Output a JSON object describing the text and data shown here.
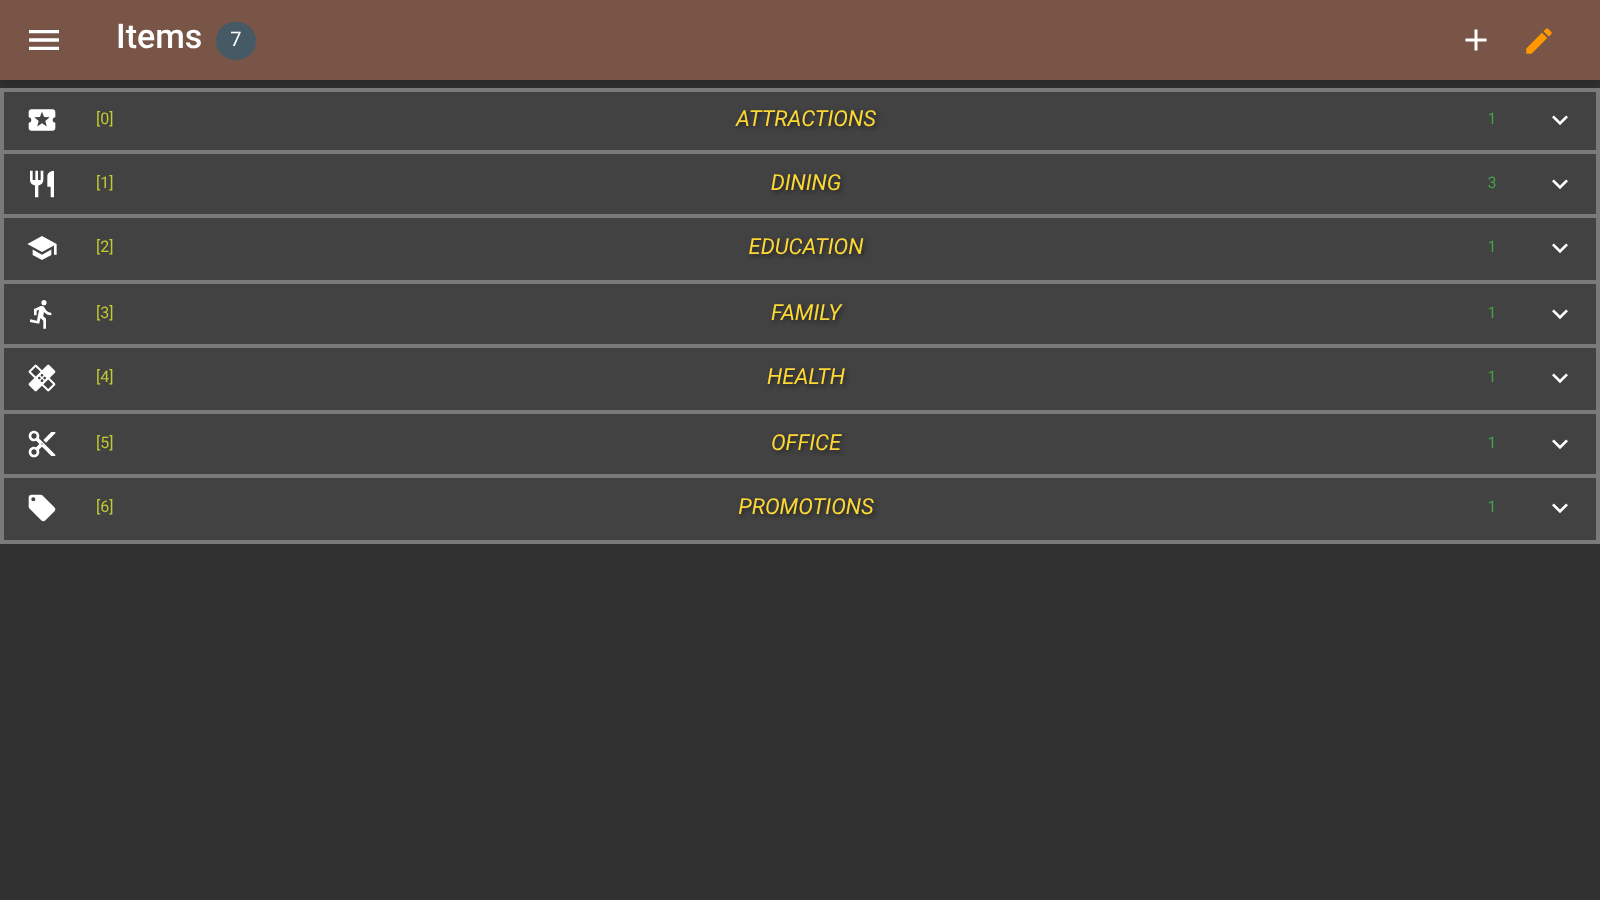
{
  "app_bar": {
    "title": "Items",
    "count": "7"
  },
  "categories": [
    {
      "index": "[0]",
      "name": "ATTRACTIONS",
      "count": "1",
      "expanded": false
    },
    {
      "index": "[1]",
      "name": "DINING",
      "count": "3",
      "expanded": false
    },
    {
      "index": "[2]",
      "name": "EDUCATION",
      "count": "1",
      "expanded": false
    },
    {
      "index": "[3]",
      "name": "FAMILY",
      "count": "1",
      "expanded": false
    },
    {
      "index": "[4]",
      "name": "HEALTH",
      "count": "1",
      "expanded": false
    },
    {
      "index": "[5]",
      "name": "OFFICE",
      "count": "1",
      "expanded": false
    },
    {
      "index": "[6]",
      "name": "PROMOTIONS",
      "count": "1",
      "expanded": false
    }
  ]
}
